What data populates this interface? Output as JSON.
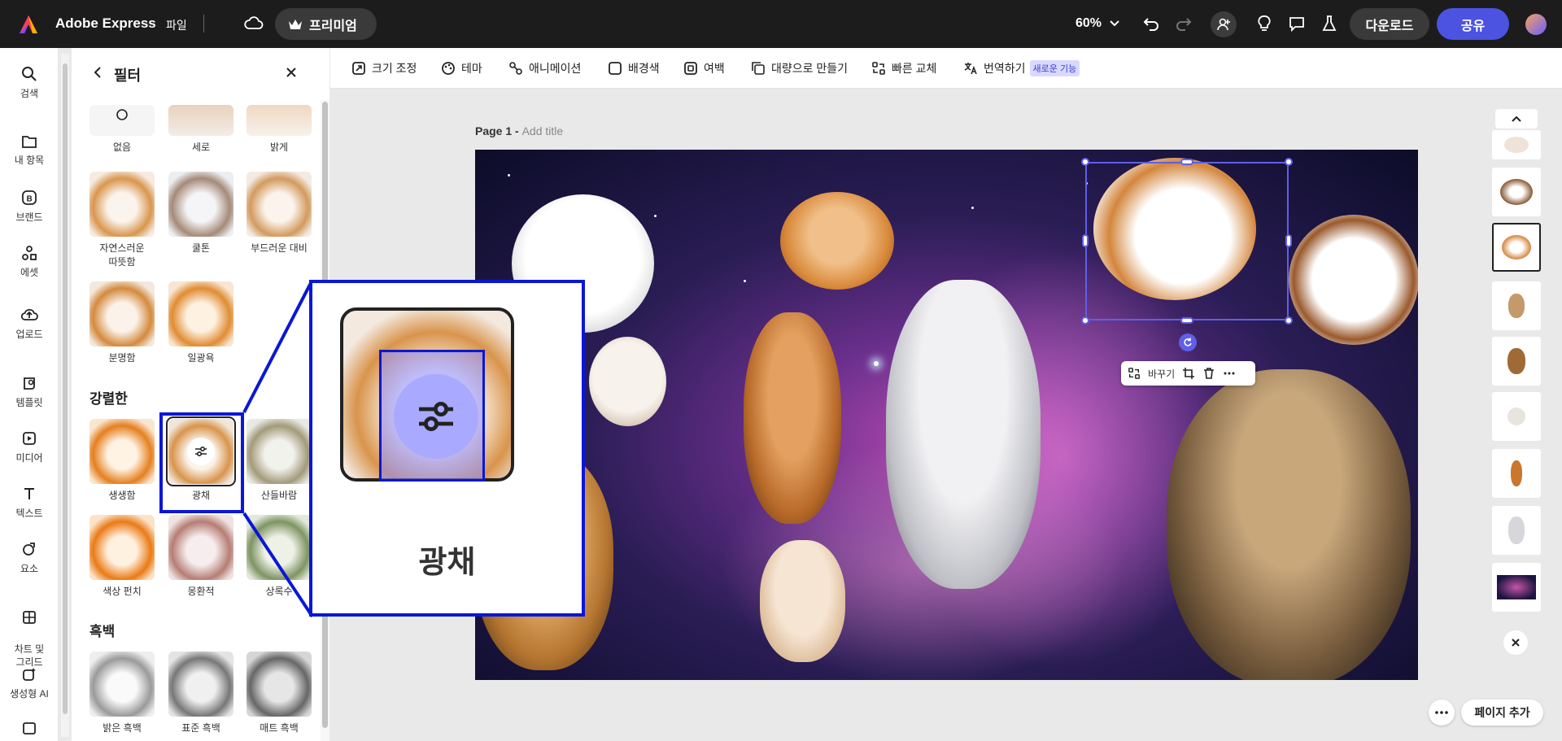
{
  "app": {
    "name": "Adobe Express",
    "file_menu": "파일",
    "premium_label": "프리미엄",
    "zoom": "60%",
    "download_label": "다운로드",
    "share_label": "공유",
    "accent_color": "#4b53e0"
  },
  "rail": {
    "items": [
      {
        "label": "검색",
        "icon": "search-icon"
      },
      {
        "label": "내 항목",
        "icon": "folder-icon"
      },
      {
        "label": "브랜드",
        "icon": "brand-icon"
      },
      {
        "label": "에셋",
        "icon": "assets-icon"
      },
      {
        "label": "업로드",
        "icon": "upload-icon"
      },
      {
        "label": "템플릿",
        "icon": "template-icon"
      },
      {
        "label": "미디어",
        "icon": "media-icon"
      },
      {
        "label": "텍스트",
        "icon": "text-icon"
      },
      {
        "label": "요소",
        "icon": "elements-icon"
      },
      {
        "label": "차트 및\n그리드",
        "icon": "chart-grid-icon"
      },
      {
        "label": "생성형 AI",
        "icon": "generative-ai-icon"
      }
    ]
  },
  "panel": {
    "title": "필터",
    "top_filters": [
      "없음",
      "세로",
      "밝게"
    ],
    "row2": [
      "자연스러운\n따뜻함",
      "쿨톤",
      "부드러운 대비"
    ],
    "row3": [
      "분명함",
      "일광욕"
    ],
    "section_intense": "강렬한",
    "intense_row1": [
      "생생함",
      "광채",
      "산들바람"
    ],
    "intense_row2": [
      "색상 펀치",
      "몽환적",
      "상록수"
    ],
    "section_bw": "흑백",
    "bw_row": [
      "밝은 흑백",
      "표준 흑백",
      "매트 흑백"
    ],
    "selected_filter": "광채"
  },
  "callout": {
    "label": "광채"
  },
  "toolbar": {
    "items": [
      "크기 조정",
      "테마",
      "애니메이션",
      "배경색",
      "여백",
      "대량으로 만들기",
      "빠른 교체",
      "번역하기"
    ],
    "new_badge": "새로운 기능"
  },
  "canvas": {
    "page_label": "Page 1 - ",
    "add_title": "Add title",
    "float_bar_replace": "바꾸기"
  },
  "footer": {
    "add_page": "페이지 추가"
  }
}
